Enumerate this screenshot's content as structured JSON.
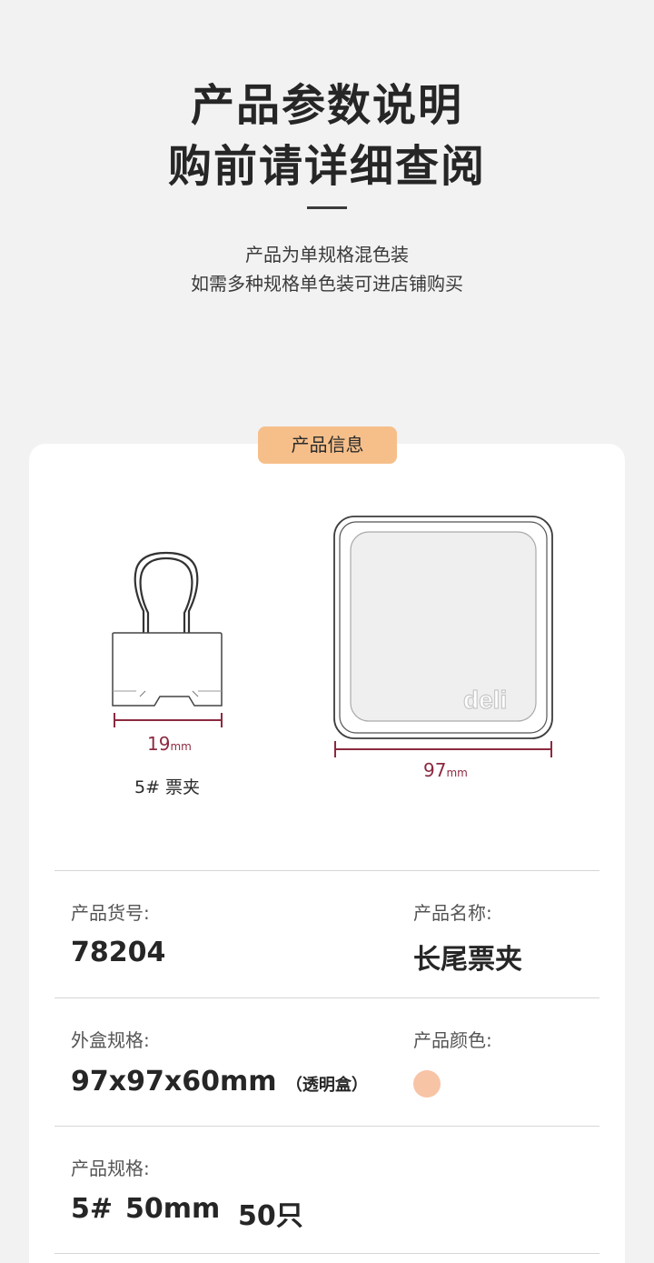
{
  "header": {
    "title_line1": "产品参数说明",
    "title_line2": "购前请详细查阅",
    "sub_line1": "产品为单规格混色装",
    "sub_line2": "如需多种规格单色装可进店铺购买"
  },
  "card": {
    "tag": "产品信息",
    "clip": {
      "width_value": "19",
      "unit": "mm",
      "name": "5# 票夹"
    },
    "box": {
      "width_value": "97",
      "unit": "mm",
      "logo": "deli"
    },
    "dimension_color": "#8c2a40"
  },
  "specs": {
    "item_no_label": "产品货号:",
    "item_no": "78204",
    "name_label": "产品名称:",
    "name": "长尾票夹",
    "box_label": "外盒规格:",
    "box_value": "97x97x60mm",
    "box_note": "（透明盒）",
    "color_label": "产品颜色:",
    "color_hex": "#f7c4a6",
    "spec_label": "产品规格:",
    "spec_size": "5#",
    "spec_length": "50mm",
    "spec_qty": "50只"
  }
}
